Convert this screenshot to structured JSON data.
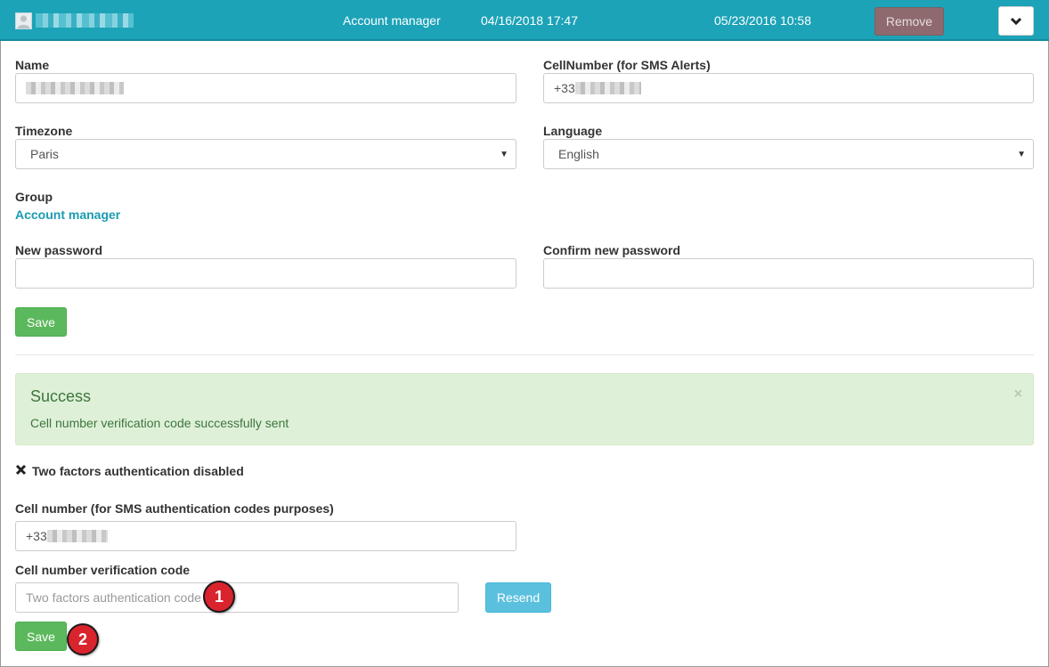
{
  "header": {
    "group": "Account manager",
    "date1": "04/16/2018 17:47",
    "date2": "05/23/2016 10:58",
    "remove_label": "Remove"
  },
  "form": {
    "name_label": "Name",
    "cell_label": "CellNumber (for SMS Alerts)",
    "cell_prefix": "+33",
    "timezone_label": "Timezone",
    "timezone_value": "Paris",
    "language_label": "Language",
    "language_value": "English",
    "group_label": "Group",
    "group_value": "Account manager",
    "new_password_label": "New password",
    "confirm_password_label": "Confirm new password",
    "save_label": "Save"
  },
  "alert": {
    "title": "Success",
    "message": "Cell number verification code successfully sent",
    "close": "×"
  },
  "twofa": {
    "status": "Two factors authentication disabled",
    "cell_label": "Cell number (for SMS authentication codes purposes)",
    "cell_prefix": "+33",
    "code_label": "Cell number verification code",
    "code_placeholder": "Two factors authentication code",
    "resend_label": "Resend",
    "save_label": "Save"
  },
  "callouts": {
    "one": "1",
    "two": "2"
  },
  "colors": {
    "header": "#1ca3b8",
    "save": "#5cb85c",
    "resend": "#5bc0de",
    "remove": "#8e6a6e",
    "badge": "#d9232d",
    "alert_bg": "#dff0d8"
  }
}
